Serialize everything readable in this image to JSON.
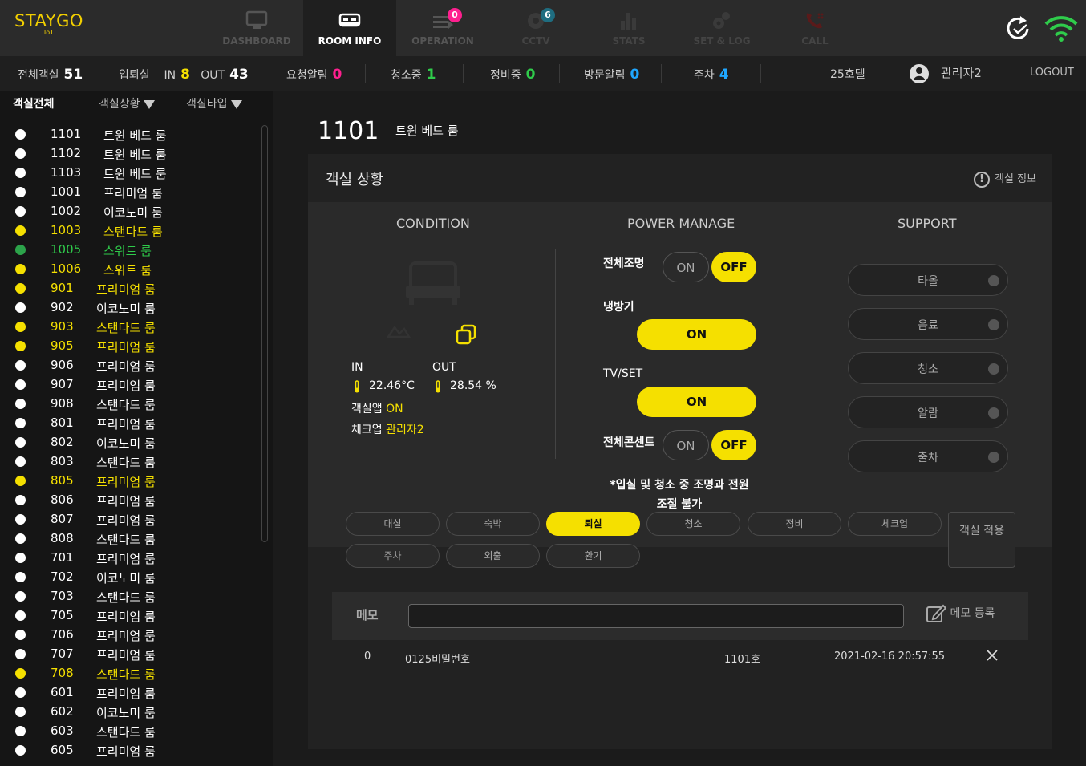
{
  "brand": {
    "name": "STAYGO",
    "sub": "IoT"
  },
  "nav": [
    {
      "label": "DASHBOARD",
      "icon": "monitor-icon"
    },
    {
      "label": "ROOM INFO",
      "icon": "bed-icon",
      "active": true
    },
    {
      "label": "OPERATION",
      "icon": "operation-icon",
      "badge": "0"
    },
    {
      "label": "CCTV",
      "icon": "camera-icon",
      "badge": "6"
    },
    {
      "label": "STATS",
      "icon": "bar-chart-icon"
    },
    {
      "label": "SET & LOG",
      "icon": "gears-icon"
    },
    {
      "label": "CALL",
      "icon": "phone-icon"
    }
  ],
  "status": {
    "total_label": "전체객실",
    "total": "51",
    "checkin_label": "입퇴실",
    "in_label": "IN",
    "in": "8",
    "out_label": "OUT",
    "out": "43",
    "request_label": "요청알림",
    "request": "0",
    "cleaning_label": "청소중",
    "cleaning": "1",
    "maintenance_label": "정비중",
    "maintenance": "0",
    "visit_label": "방문알림",
    "visit": "0",
    "parking_label": "주차",
    "parking": "4",
    "hotel": "25호텔",
    "user": "관리자2",
    "logout": "LOGOUT"
  },
  "filters": {
    "all": "객실전체",
    "status": "객실상황",
    "type": "객실타입"
  },
  "rooms": [
    {
      "num": "1101",
      "type": "트윈 베드 룸",
      "color": "white"
    },
    {
      "num": "1102",
      "type": "트윈 베드 룸",
      "color": "white"
    },
    {
      "num": "1103",
      "type": "트윈 베드 룸",
      "color": "white"
    },
    {
      "num": "1001",
      "type": "프리미엄 룸",
      "color": "white"
    },
    {
      "num": "1002",
      "type": "이코노미 룸",
      "color": "white"
    },
    {
      "num": "1003",
      "type": "스탠다드 룸",
      "color": "yellow"
    },
    {
      "num": "1005",
      "type": "스위트 룸",
      "color": "green"
    },
    {
      "num": "1006",
      "type": "스위트 룸",
      "color": "yellow"
    },
    {
      "num": "901",
      "type": "프리미엄 룸",
      "color": "yellow"
    },
    {
      "num": "902",
      "type": "이코노미 룸",
      "color": "white"
    },
    {
      "num": "903",
      "type": "스탠다드 룸",
      "color": "yellow"
    },
    {
      "num": "905",
      "type": "프리미엄 룸",
      "color": "yellow"
    },
    {
      "num": "906",
      "type": "프리미엄 룸",
      "color": "white"
    },
    {
      "num": "907",
      "type": "프리미엄 룸",
      "color": "white"
    },
    {
      "num": "908",
      "type": "스탠다드 룸",
      "color": "white"
    },
    {
      "num": "801",
      "type": "프리미엄 룸",
      "color": "white"
    },
    {
      "num": "802",
      "type": "이코노미 룸",
      "color": "white"
    },
    {
      "num": "803",
      "type": "스탠다드 룸",
      "color": "white"
    },
    {
      "num": "805",
      "type": "프리미엄 룸",
      "color": "yellow"
    },
    {
      "num": "806",
      "type": "프리미엄 룸",
      "color": "white"
    },
    {
      "num": "807",
      "type": "프리미엄 룸",
      "color": "white"
    },
    {
      "num": "808",
      "type": "스탠다드 룸",
      "color": "white"
    },
    {
      "num": "701",
      "type": "프리미엄 룸",
      "color": "white"
    },
    {
      "num": "702",
      "type": "이코노미 룸",
      "color": "white"
    },
    {
      "num": "703",
      "type": "스탠다드 룸",
      "color": "white"
    },
    {
      "num": "705",
      "type": "프리미엄 룸",
      "color": "white"
    },
    {
      "num": "706",
      "type": "프리미엄 룸",
      "color": "white"
    },
    {
      "num": "707",
      "type": "프리미엄 룸",
      "color": "white"
    },
    {
      "num": "708",
      "type": "스탠다드 룸",
      "color": "yellow"
    },
    {
      "num": "601",
      "type": "프리미엄 룸",
      "color": "white"
    },
    {
      "num": "602",
      "type": "이코노미 룸",
      "color": "white"
    },
    {
      "num": "603",
      "type": "스탠다드 룸",
      "color": "white"
    },
    {
      "num": "605",
      "type": "프리미엄 룸",
      "color": "white"
    }
  ],
  "selected": {
    "num": "1101",
    "type": "트윈 베드 룸"
  },
  "card": {
    "title": "객실 상황",
    "info": "객실 정보",
    "info_icon": "!"
  },
  "columns": {
    "condition": "CONDITION",
    "power": "POWER MANAGE",
    "support": "SUPPORT"
  },
  "condition": {
    "in_label": "IN",
    "out_label": "OUT",
    "in_temp": "22.46°C",
    "out_humid": "28.54 %",
    "app_label": "객실앱",
    "app_value": "ON",
    "checkup_label": "체크업",
    "checkup_value": "관리자2"
  },
  "power": {
    "lights_label": "전체조명",
    "ac_label": "냉방기",
    "tv_label": "TV/SET",
    "outlet_label": "전체콘센트",
    "on": "ON",
    "off": "OFF",
    "note": "*입실 및 청소 중 조명과 전원 조절 불가"
  },
  "support": [
    "타올",
    "음료",
    "청소",
    "알람",
    "출차"
  ],
  "state_buttons": [
    "대실",
    "숙박",
    "퇴실",
    "청소",
    "정비",
    "체크업",
    "주차",
    "외출",
    "환기"
  ],
  "active_state": "퇴실",
  "apply_label": "객실 적용",
  "memo": {
    "label": "메모",
    "input_value": "",
    "register": "메모 등록",
    "rows": [
      {
        "no": "0",
        "text": "0125비밀번호",
        "room": "1101호",
        "date": "2021-02-16 20:57:55"
      }
    ]
  },
  "colors": {
    "accent": "#f5e000",
    "green": "#2fcc4b",
    "pink": "#ff1f8f",
    "blue": "#1fa7ff",
    "brand": "#f2cf00"
  }
}
